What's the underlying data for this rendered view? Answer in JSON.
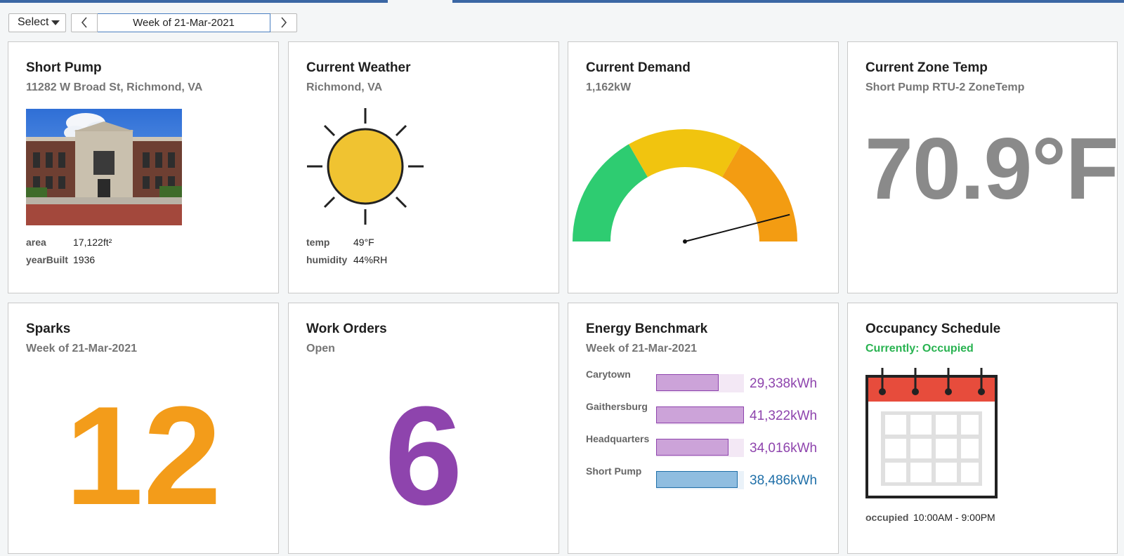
{
  "toolbar": {
    "select_label": "Select",
    "week_label": "Week of 21-Mar-2021"
  },
  "site": {
    "title": "Short Pump",
    "address": "11282 W Broad St, Richmond, VA",
    "area_label": "area",
    "area_value": "17,122ft²",
    "year_label": "yearBuilt",
    "year_value": "1936"
  },
  "weather": {
    "title": "Current Weather",
    "location": "Richmond, VA",
    "temp_label": "temp",
    "temp_value": "49°F",
    "humidity_label": "humidity",
    "humidity_value": "44%RH",
    "icon": "sun-icon"
  },
  "demand": {
    "title": "Current Demand",
    "value": "1,162kW",
    "gauge_fraction": 0.92,
    "colors": {
      "low": "#2ecc71",
      "mid": "#f1c40f",
      "high": "#f39c12"
    }
  },
  "zone": {
    "title": "Current Zone Temp",
    "point": "Short Pump RTU-2 ZoneTemp",
    "value": "70.9°F"
  },
  "sparks": {
    "title": "Sparks",
    "week": "Week of 21-Mar-2021",
    "count": "12",
    "color": "#f39c1a"
  },
  "work_orders": {
    "title": "Work Orders",
    "status": "Open",
    "count": "6",
    "color": "#8e44ad"
  },
  "benchmark": {
    "title": "Energy Benchmark",
    "week": "Week of 21-Mar-2021",
    "max": 41322,
    "rows": [
      {
        "name": "Carytown",
        "value": 29338,
        "label": "29,338kWh",
        "highlight": false
      },
      {
        "name": "Gaithersburg",
        "value": 41322,
        "label": "41,322kWh",
        "highlight": false
      },
      {
        "name": "Headquarters",
        "value": 34016,
        "label": "34,016kWh",
        "highlight": false
      },
      {
        "name": "Short Pump",
        "value": 38486,
        "label": "38,486kWh",
        "highlight": true
      }
    ]
  },
  "occupancy": {
    "title": "Occupancy Schedule",
    "status": "Currently: Occupied",
    "label": "occupied",
    "hours": "10:00AM - 9:00PM",
    "icon": "calendar-icon"
  }
}
